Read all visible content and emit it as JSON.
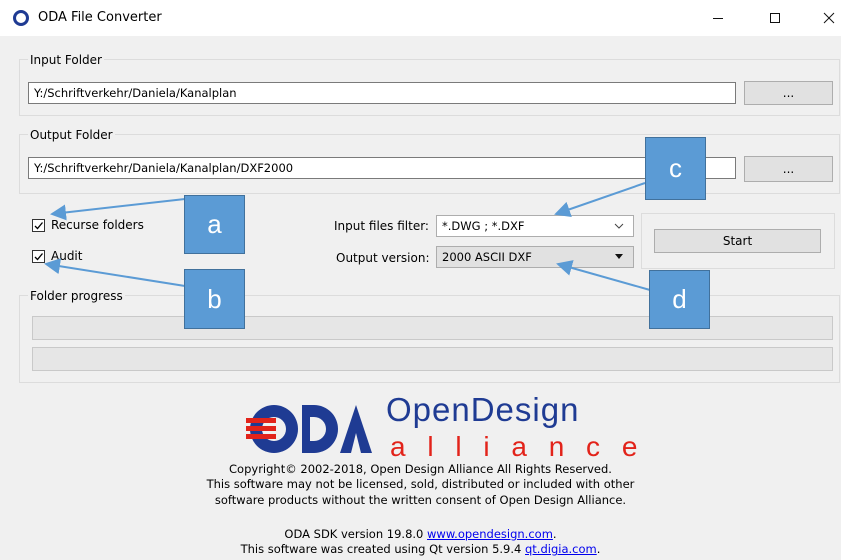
{
  "window": {
    "title": "ODA File Converter",
    "minimize_icon": "minimize-icon",
    "maximize_icon": "maximize-icon",
    "close_icon": "close-icon"
  },
  "input_folder": {
    "group_label": "Input Folder",
    "path": "Y:/Schriftverkehr/Daniela/Kanalplan",
    "browse_label": "..."
  },
  "output_folder": {
    "group_label": "Output Folder",
    "path": "Y:/Schriftverkehr/Daniela/Kanalplan/DXF2000",
    "browse_label": "..."
  },
  "options": {
    "recurse_label": "Recurse folders",
    "recurse_checked": true,
    "audit_label": "Audit",
    "audit_checked": true,
    "filter_label": "Input files filter:",
    "filter_value": "*.DWG ; *.DXF",
    "version_label": "Output version:",
    "version_value": "2000 ASCII DXF",
    "start_label": "Start"
  },
  "progress": {
    "group_label": "Folder progress",
    "folder_value": 0,
    "file_value": 0
  },
  "callouts": {
    "a": "a",
    "b": "b",
    "c": "c",
    "d": "d",
    "color": "#5b9bd5"
  },
  "logo": {
    "oda": "ODA",
    "opendesign": "OpenDesign",
    "alliance": "a l l i a n c e",
    "colors": {
      "navy": "#1f3b93",
      "red": "#e2231a"
    }
  },
  "footer": {
    "copyright": "Copyright© 2002-2018, Open Design Alliance All Rights Reserved.",
    "license_1": "This software may not be licensed, sold, distributed or included with other",
    "license_2": "software products without the written consent of Open Design Alliance.",
    "sdk_prefix": "ODA SDK version 19.8.0 ",
    "sdk_link": "www.opendesign.com",
    "sdk_suffix": ".",
    "qt_prefix": "This software was created using Qt version 5.9.4 ",
    "qt_link": "qt.digia.com",
    "qt_suffix": "."
  }
}
